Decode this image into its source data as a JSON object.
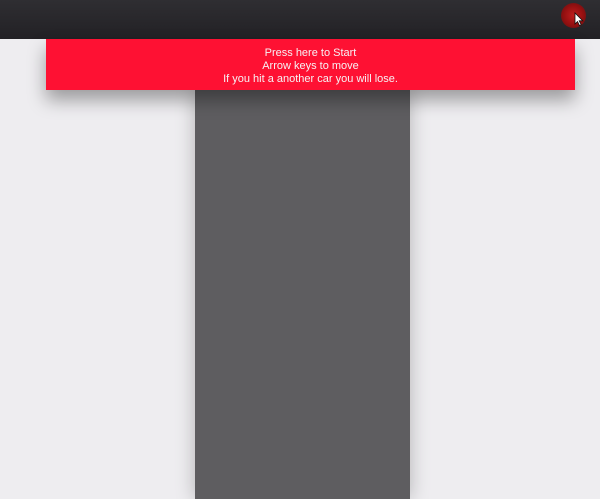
{
  "banner": {
    "line1": "Press here to Start",
    "line2": "Arrow keys to move",
    "line3": "If you hit a another car you will lose."
  },
  "colors": {
    "banner": "#fe1133",
    "road": "#5e5d60",
    "background": "#eeedf0",
    "topbar": "#2a292d"
  },
  "icons": {
    "cursor": "mouse-pointer-icon",
    "click_indicator": "click-ripple-icon"
  }
}
